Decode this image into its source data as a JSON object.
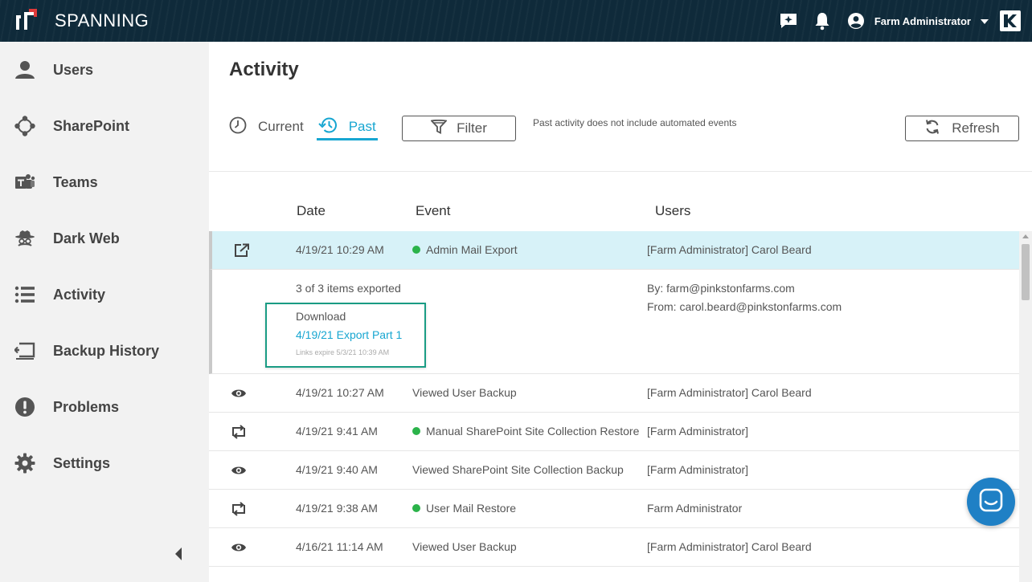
{
  "app": {
    "name": "SPANNING"
  },
  "header": {
    "user_name": "Farm Administrator",
    "icons": [
      "feedback-icon",
      "bell-icon",
      "user-circle-icon",
      "chevron-down-icon",
      "kaseya-logo"
    ]
  },
  "sidebar": {
    "items": [
      {
        "label": "Users",
        "icon": "user-icon"
      },
      {
        "label": "SharePoint",
        "icon": "sharepoint-icon"
      },
      {
        "label": "Teams",
        "icon": "teams-icon"
      },
      {
        "label": "Dark Web",
        "icon": "spy-icon"
      },
      {
        "label": "Activity",
        "icon": "list-icon"
      },
      {
        "label": "Backup History",
        "icon": "backup-history-icon"
      },
      {
        "label": "Problems",
        "icon": "alert-icon"
      },
      {
        "label": "Settings",
        "icon": "gear-icon"
      }
    ]
  },
  "main": {
    "title": "Activity",
    "tabs": {
      "current": "Current",
      "past": "Past"
    },
    "filter_label": "Filter",
    "note": "Past activity does not include automated events",
    "refresh_label": "Refresh",
    "columns": {
      "date": "Date",
      "event": "Event",
      "users": "Users"
    },
    "rows": [
      {
        "icon": "export-icon",
        "date": "4/19/21 10:29 AM",
        "event": "Admin Mail Export",
        "status_dot": true,
        "users": "[Farm Administrator] Carol Beard",
        "selected": true
      },
      {
        "icon": "eye-icon",
        "date": "4/19/21 10:27 AM",
        "event": "Viewed User Backup",
        "status_dot": false,
        "users": "[Farm Administrator] Carol Beard"
      },
      {
        "icon": "restore-icon",
        "date": "4/19/21 9:41 AM",
        "event": "Manual SharePoint Site Collection Restore",
        "status_dot": true,
        "users": "[Farm Administrator]"
      },
      {
        "icon": "eye-icon",
        "date": "4/19/21 9:40 AM",
        "event": "Viewed SharePoint Site Collection Backup",
        "status_dot": false,
        "users": "[Farm Administrator]"
      },
      {
        "icon": "restore-icon",
        "date": "4/19/21 9:38 AM",
        "event": "User Mail Restore",
        "status_dot": true,
        "users": "Farm Administrator"
      },
      {
        "icon": "eye-icon",
        "date": "4/16/21 11:14 AM",
        "event": "Viewed User Backup",
        "status_dot": false,
        "users": "[Farm Administrator] Carol Beard"
      }
    ],
    "details": {
      "summary": "3 of 3 items exported",
      "by": "By: farm@pinkstonfarms.com",
      "from": "From: carol.beard@pinkstonfarms.com",
      "download_title": "Download",
      "download_link": "4/19/21 Export Part 1",
      "expire_note": "Links expire 5/3/21 10:39 AM"
    }
  },
  "colors": {
    "accent": "#17a6d1",
    "topbar": "#0f2a3a",
    "success": "#2bb34a",
    "highlight_border": "#1a9c84",
    "chat": "#1f80c5"
  }
}
